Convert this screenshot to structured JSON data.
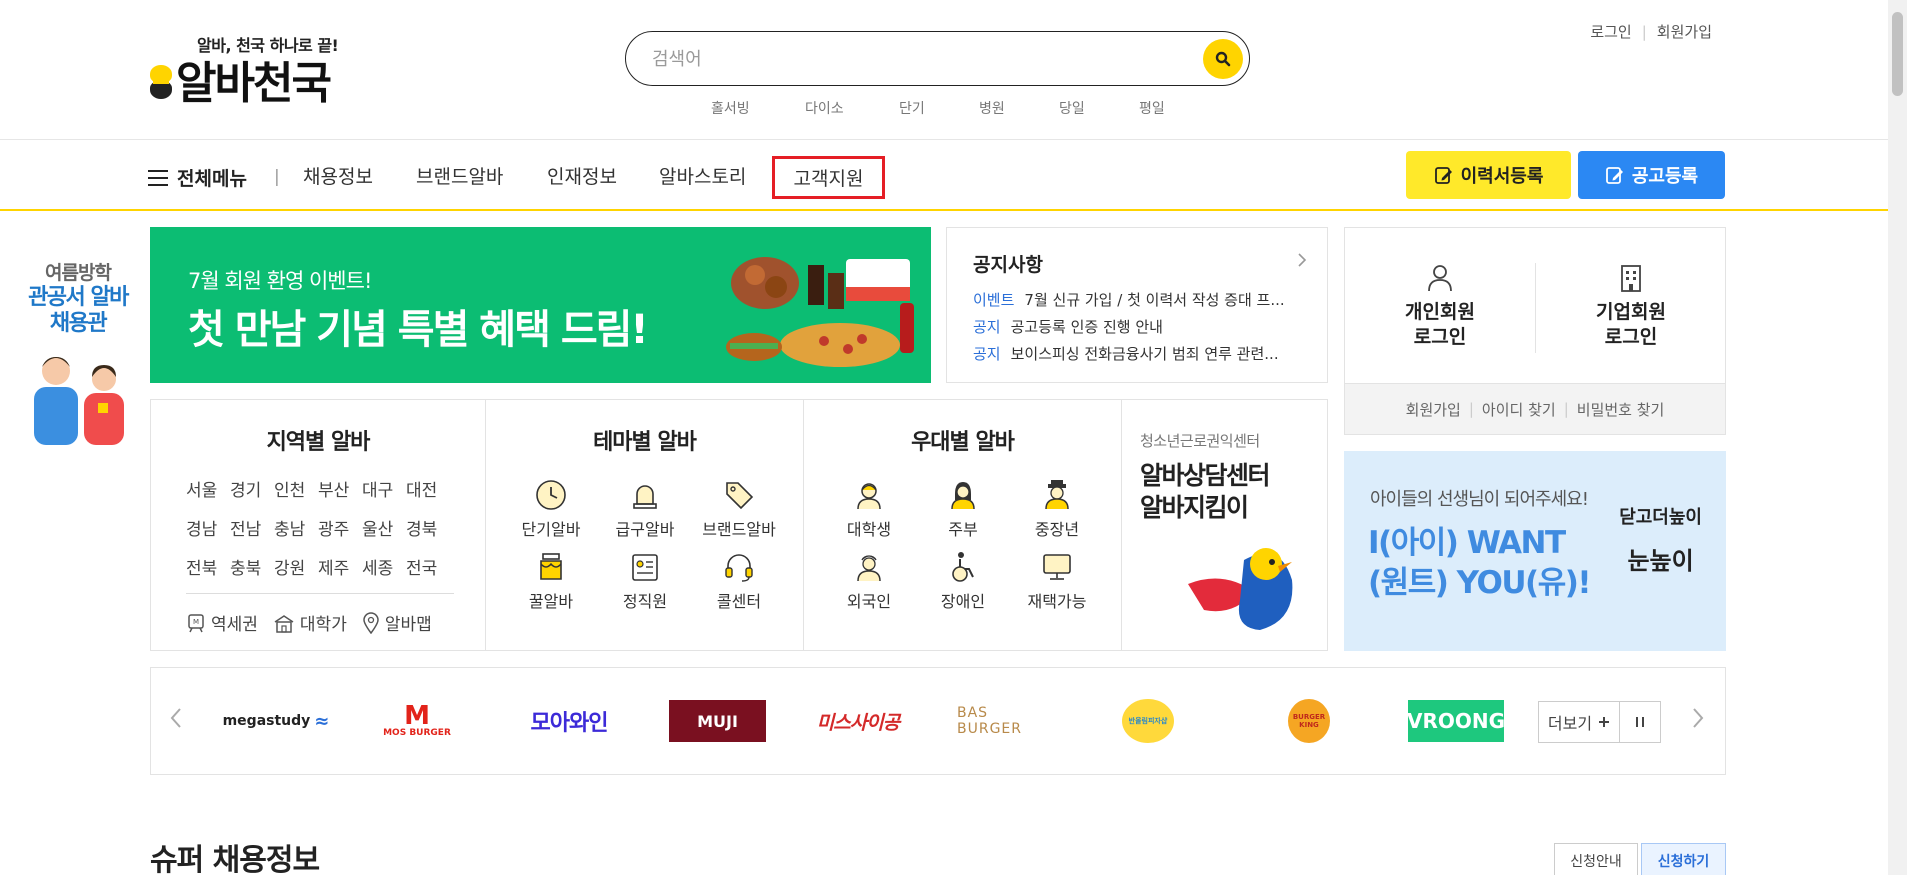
{
  "header": {
    "tagline": "알바, 천국 하나로 끝!",
    "logo_text": "알바천국",
    "search_placeholder": "검색어",
    "keywords": [
      "홀서빙",
      "다이소",
      "단기",
      "병원",
      "당일",
      "평일"
    ],
    "login": "로그인",
    "signup": "회원가입"
  },
  "nav": {
    "all_menu": "전체메뉴",
    "separator": "|",
    "items": [
      "채용정보",
      "브랜드알바",
      "인재정보",
      "알바스토리",
      "고객지원"
    ],
    "resume_button": "이력서등록",
    "post_button": "공고등록"
  },
  "side_promo": {
    "line1": "여름방학",
    "line2": "관공서 알바",
    "line3": "채용관"
  },
  "banner": {
    "subtitle": "7월 회원 환영 이벤트!",
    "title": "첫 만남 기념 특별 혜택 드림!"
  },
  "notice": {
    "title": "공지사항",
    "items": [
      {
        "category": "이벤트",
        "text": "7월 신규 가입 / 첫 이력서 작성 증대 프..."
      },
      {
        "category": "공지",
        "text": "공고등록 인증 진행 안내"
      },
      {
        "category": "공지",
        "text": "보이스피싱 전화금융사기 범죄 연루 관련..."
      }
    ]
  },
  "login_box": {
    "personal_line1": "개인회원",
    "personal_line2": "로그인",
    "company_line1": "기업회원",
    "company_line2": "로그인",
    "signup": "회원가입",
    "find_id": "아이디 찾기",
    "find_pw": "비밀번호 찾기"
  },
  "regions": {
    "title": "지역별 알바",
    "items": [
      "서울",
      "경기",
      "인천",
      "부산",
      "대구",
      "대전",
      "경남",
      "전남",
      "충남",
      "광주",
      "울산",
      "경북",
      "전북",
      "충북",
      "강원",
      "제주",
      "세종",
      "전국"
    ],
    "links": [
      "역세권",
      "대학가",
      "알바맵"
    ]
  },
  "themes": {
    "title": "테마별 알바",
    "items": [
      {
        "label": "단기알바",
        "icon": "clock-icon"
      },
      {
        "label": "급구알바",
        "icon": "siren-icon"
      },
      {
        "label": "브랜드알바",
        "icon": "tag-icon"
      },
      {
        "label": "꿀알바",
        "icon": "honey-jar-icon"
      },
      {
        "label": "정직원",
        "icon": "id-card-icon"
      },
      {
        "label": "콜센터",
        "icon": "headset-icon"
      }
    ]
  },
  "benefits": {
    "title": "우대별 알바",
    "items": [
      {
        "label": "대학생",
        "icon": "student-icon"
      },
      {
        "label": "주부",
        "icon": "homemaker-icon"
      },
      {
        "label": "중장년",
        "icon": "senior-icon"
      },
      {
        "label": "외국인",
        "icon": "foreigner-icon"
      },
      {
        "label": "장애인",
        "icon": "wheelchair-icon"
      },
      {
        "label": "재택가능",
        "icon": "monitor-icon"
      }
    ]
  },
  "youth": {
    "subtitle": "청소년근로권익센터",
    "line1": "알바상담센터",
    "line2": "알바지킴이"
  },
  "ad": {
    "subtitle": "아이들의 선생님이 되어주세요!",
    "line1": "I(아이) WANT",
    "line2": "(원트) YOU(유)!",
    "brand_top": "닫고더높이",
    "brand_bottom": "눈높이"
  },
  "brands": {
    "items": [
      "megastudy",
      "MOS BURGER",
      "모아와인",
      "MUJI",
      "미스사이공",
      "BAS BURGER",
      "반올림피자샵",
      "BURGER KING",
      "VROONG"
    ],
    "more": "더보기"
  },
  "super": {
    "title": "슈퍼 채용정보",
    "guide": "신청안내",
    "apply": "신청하기"
  },
  "colors": {
    "brand_yellow": "#ffd400",
    "resume_yellow": "#ffe92a",
    "post_blue": "#2b88f3",
    "banner_green": "#0cbd73",
    "highlight_red": "#e51e25",
    "notice_blue": "#2b6fd8"
  }
}
